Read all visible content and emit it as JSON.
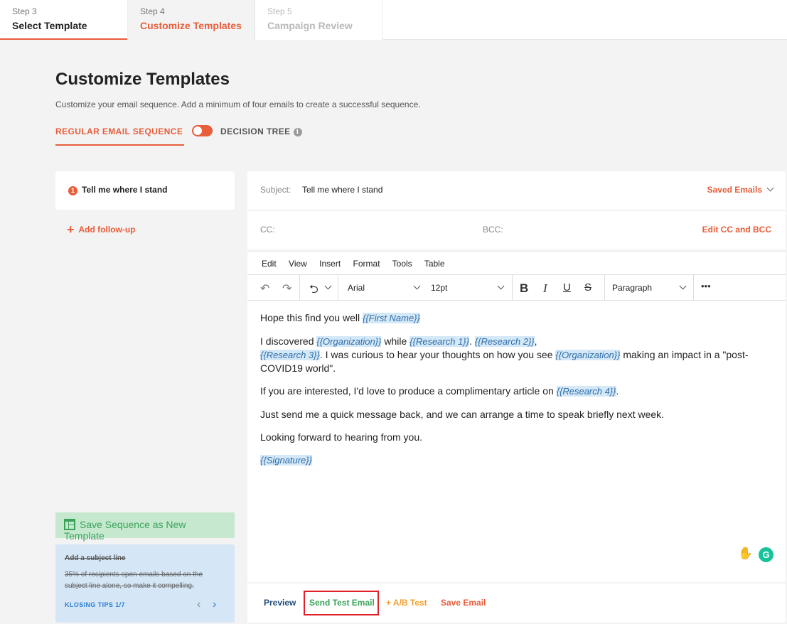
{
  "steps": [
    {
      "num": "Step 3",
      "name": "Select Template"
    },
    {
      "num": "Step 4",
      "name": "Customize Templates"
    },
    {
      "num": "Step 5",
      "name": "Campaign Review"
    }
  ],
  "page": {
    "title": "Customize Templates",
    "description": "Customize your email sequence. Add a minimum of four emails to create a successful sequence."
  },
  "mode": {
    "regular": "REGULAR EMAIL SEQUENCE",
    "tree": "DECISION TREE",
    "toggle_state": "regular"
  },
  "sequence": {
    "items": [
      {
        "index": "1",
        "label": "Tell me where I stand"
      }
    ],
    "add_follow_up": "Add follow-up",
    "save_template": "Save Sequence as New Template"
  },
  "tips": {
    "title": "Add a subject line",
    "text": "35% of recipients open emails based on the subject line alone, so make it compelling.",
    "counter": "KLOSING TIPS 1/7"
  },
  "subject": {
    "label": "Subject:",
    "value": "Tell me where I stand",
    "saved_emails": "Saved Emails"
  },
  "cc": {
    "cc_label": "CC:",
    "bcc_label": "BCC:",
    "edit": "Edit CC and BCC"
  },
  "editor": {
    "menu": [
      "Edit",
      "View",
      "Insert",
      "Format",
      "Tools",
      "Table"
    ],
    "font": "Arial",
    "size": "12pt",
    "block": "Paragraph",
    "more": "•••",
    "body": {
      "p1a": "Hope this find you well ",
      "t_first": "{{First Name}}",
      "p2a": "I discovered ",
      "t_org": "{{Organization}}",
      "p2b": " while ",
      "t_r1": "{{Research 1}}",
      "p2c": ". ",
      "t_r2": "{{Research 2}}",
      "p2d": ",",
      "t_r3": "{{Research 3}}",
      "p2e": ". I was curious to hear your thoughts on how you see ",
      "t_org2": "{{Organization}}",
      "p2f": " making an impact in a \"post-COVID19 world\".",
      "p3a": "If you are interested, I'd love to produce a complimentary article on ",
      "t_r4": "{{Research 4}}",
      "p3b": ".",
      "p4": "Just send me a quick message back, and we can arrange a time to speak briefly next week.",
      "p5": "Looking forward to hearing from you.",
      "t_sig": "{{Signature}}"
    }
  },
  "actions": {
    "preview": "Preview",
    "send_test": "Send Test Email",
    "ab_test": "+ A/B Test",
    "save": "Save Email"
  },
  "colors": {
    "accent": "#e85d3a",
    "green": "#3aa35a",
    "highlight": "#e01f26",
    "token_bg": "#d4e8f8"
  }
}
